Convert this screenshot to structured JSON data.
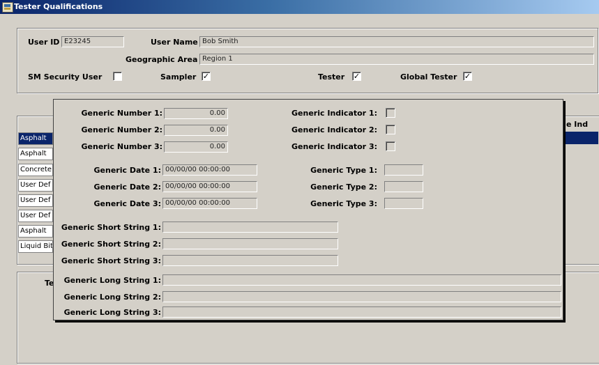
{
  "window": {
    "title": "Tester Qualifications"
  },
  "header": {
    "user_id_label": "User ID",
    "user_id_value": "E23245",
    "user_name_label": "User Name",
    "user_name_value": "Bob Smith",
    "geo_area_label": "Geographic Area",
    "geo_area_value": "Region 1",
    "sm_security_label": "SM Security User",
    "sampler_label": "Sampler",
    "tester_label": "Tester",
    "global_tester_label": "Global Tester",
    "checked_mark": "✓"
  },
  "list": {
    "column_fragment": "e Ind",
    "rows": [
      "Asphalt",
      "Asphalt",
      "Concrete",
      "User Def",
      "User Def",
      "User Def",
      "Asphalt",
      "Liquid Bit"
    ]
  },
  "lower_panel": {
    "column_fragment": "Te"
  },
  "popup": {
    "numbers": [
      {
        "label": "Generic Number 1:",
        "value": "0.00"
      },
      {
        "label": "Generic Number 2:",
        "value": "0.00"
      },
      {
        "label": "Generic Number 3:",
        "value": "0.00"
      }
    ],
    "indicators": [
      {
        "label": "Generic Indicator 1:"
      },
      {
        "label": "Generic Indicator 2:"
      },
      {
        "label": "Generic Indicator 3:"
      }
    ],
    "dates": [
      {
        "label": "Generic Date 1:",
        "value": "00/00/00 00:00:00"
      },
      {
        "label": "Generic Date 2:",
        "value": "00/00/00 00:00:00"
      },
      {
        "label": "Generic Date 3:",
        "value": "00/00/00 00:00:00"
      }
    ],
    "types": [
      {
        "label": "Generic Type 1:"
      },
      {
        "label": "Generic Type 2:"
      },
      {
        "label": "Generic Type 3:"
      }
    ],
    "short_strings": [
      {
        "label": "Generic Short String 1:"
      },
      {
        "label": "Generic Short String 2:"
      },
      {
        "label": "Generic Short String 3:"
      }
    ],
    "long_strings": [
      {
        "label": "Generic Long String 1:"
      },
      {
        "label": "Generic Long String 2:"
      },
      {
        "label": "Generic Long String 3:"
      }
    ]
  }
}
